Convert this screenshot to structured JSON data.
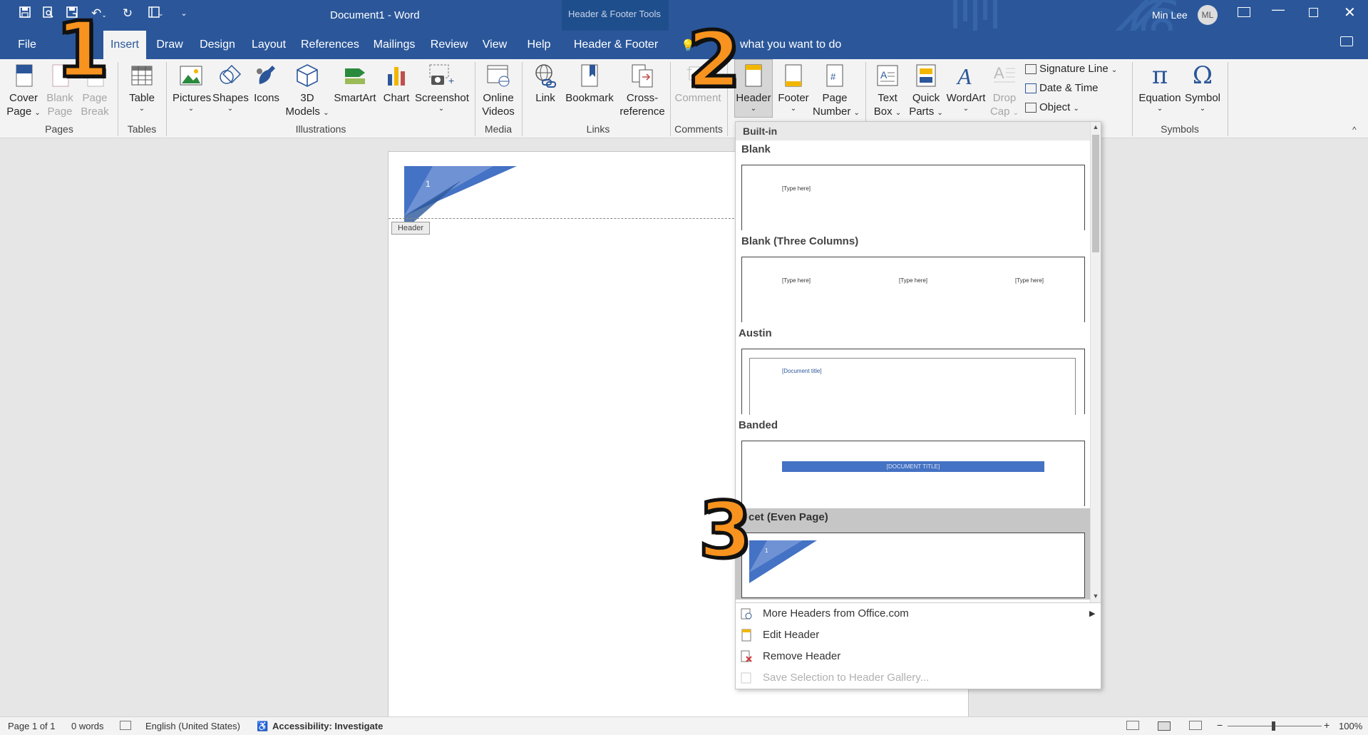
{
  "window": {
    "title": "Document1  -  Word",
    "tools_title": "Header & Footer Tools",
    "user": "Min Lee",
    "user_initials": "ML"
  },
  "tabs": [
    "File",
    "Insert",
    "Draw",
    "Design",
    "Layout",
    "References",
    "Mailings",
    "Review",
    "View",
    "Help",
    "Header & Footer"
  ],
  "tell_me": "what you want to do",
  "ribbon": {
    "pages": {
      "cover": [
        "Cover",
        "Page"
      ],
      "blank": [
        "Blank",
        "Page"
      ],
      "break": [
        "Page",
        "Break"
      ],
      "group": "Pages"
    },
    "tables": {
      "table": "Table",
      "group": "Tables"
    },
    "illustrations": {
      "pictures": "Pictures",
      "shapes": "Shapes",
      "icons": "Icons",
      "models": [
        "3D",
        "Models"
      ],
      "smartart": "SmartArt",
      "chart": "Chart",
      "screenshot": "Screenshot",
      "group": "Illustrations"
    },
    "media": {
      "videos": [
        "Online",
        "Videos"
      ],
      "group": "Media"
    },
    "links": {
      "link": "Link",
      "bookmark": "Bookmark",
      "crossref": [
        "Cross-",
        "reference"
      ],
      "group": "Links"
    },
    "comments": {
      "comment": "Comment",
      "group": "Comments"
    },
    "hf": {
      "header": "Header",
      "footer": "Footer",
      "pagenum": [
        "Page",
        "Number"
      ]
    },
    "text": {
      "textbox": [
        "Text",
        "Box"
      ],
      "quickparts": [
        "Quick",
        "Parts"
      ],
      "wordart": "WordArt",
      "dropcap": [
        "Drop",
        "Cap"
      ],
      "sigline": "Signature Line",
      "datetime": "Date & Time",
      "object": "Object"
    },
    "symbols": {
      "equation": "Equation",
      "symbol": "Symbol",
      "group": "Symbols",
      "pi": "π",
      "omega": "Ω"
    }
  },
  "document": {
    "page_number": "1",
    "header_tag": "Header"
  },
  "dropdown": {
    "section": "Built-in",
    "items": [
      {
        "name": "Blank",
        "placeholders": [
          "[Type here]"
        ]
      },
      {
        "name": "Blank (Three Columns)",
        "placeholders": [
          "[Type here]",
          "[Type here]",
          "[Type here]"
        ]
      },
      {
        "name": "Austin",
        "placeholders": [
          "[Document title]"
        ]
      },
      {
        "name": "Banded",
        "placeholders": [
          "[DOCUMENT TITLE]"
        ]
      },
      {
        "name": "cet (Even Page)",
        "placeholders": [
          "1"
        ]
      }
    ],
    "menu": [
      "More Headers from Office.com",
      "Edit Header",
      "Remove Header",
      "Save Selection to Header Gallery..."
    ]
  },
  "annotations": [
    "1",
    "2",
    "3"
  ],
  "status": {
    "page": "Page 1 of 1",
    "words": "0 words",
    "language": "English (United States)",
    "accessibility": "Accessibility: Investigate",
    "zoom": "100%"
  },
  "colors": {
    "accent": "#2b579a",
    "orange": "#f7931e",
    "banded": "#4472c4"
  }
}
